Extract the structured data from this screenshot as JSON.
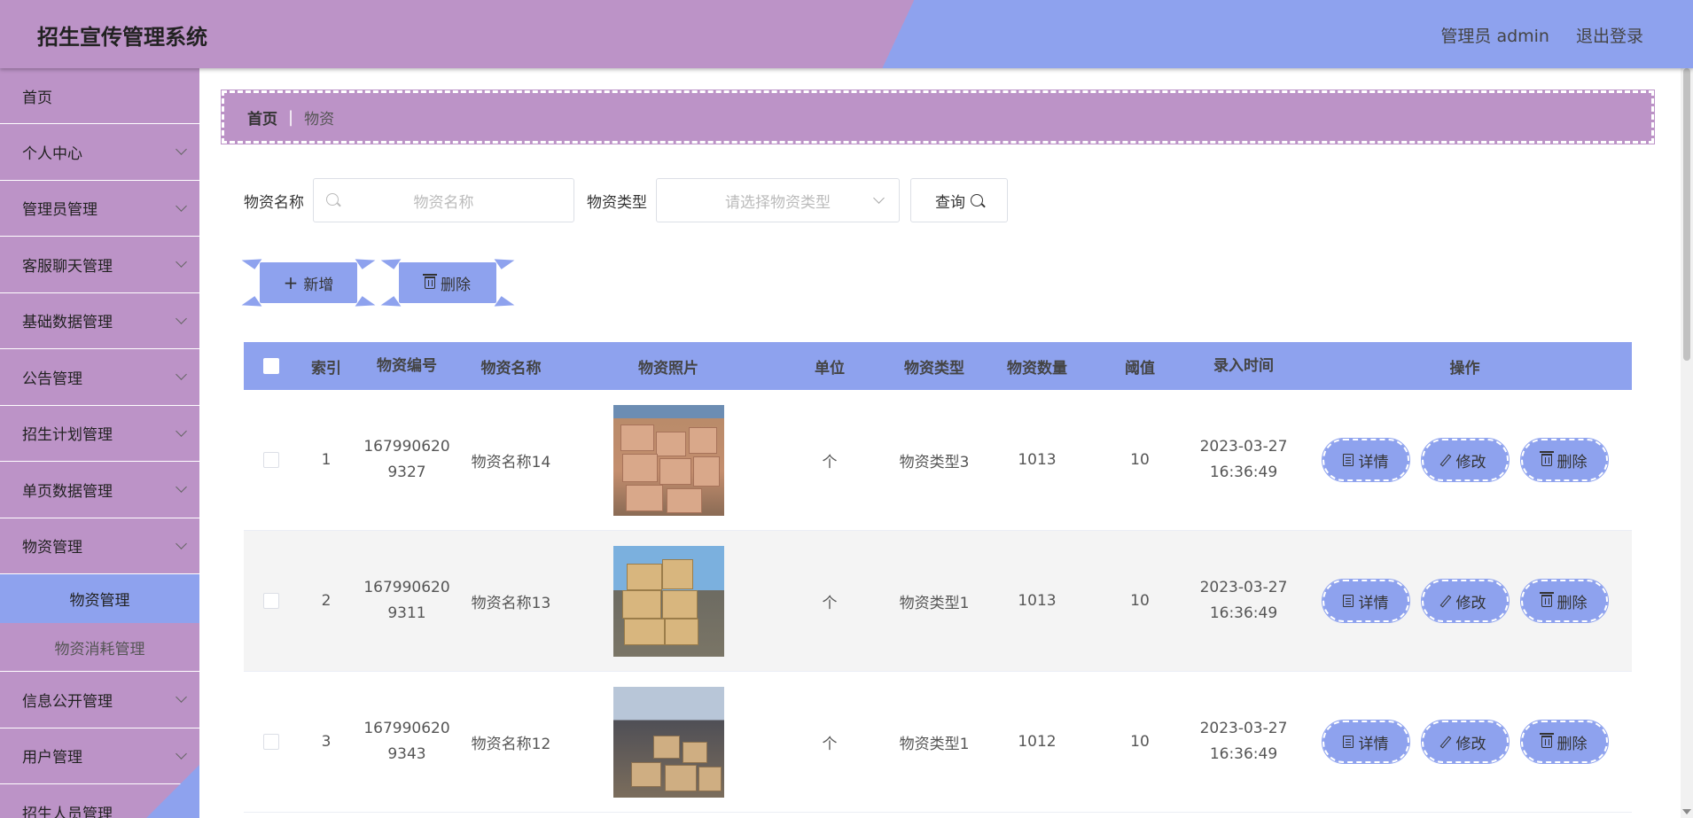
{
  "header": {
    "title": "招生宣传管理系统",
    "user_label": "管理员 admin",
    "logout_label": "退出登录"
  },
  "sidebar": {
    "items": [
      {
        "label": "首页"
      },
      {
        "label": "个人中心"
      },
      {
        "label": "管理员管理"
      },
      {
        "label": "客服聊天管理"
      },
      {
        "label": "基础数据管理"
      },
      {
        "label": "公告管理"
      },
      {
        "label": "招生计划管理"
      },
      {
        "label": "单页数据管理"
      },
      {
        "label": "物资管理"
      },
      {
        "label": "信息公开管理"
      },
      {
        "label": "用户管理"
      },
      {
        "label": "招生人员管理"
      }
    ],
    "submenu": {
      "active": "物资管理",
      "other": "物资消耗管理"
    }
  },
  "breadcrumb": {
    "home": "首页",
    "separator": "|",
    "current": "物资"
  },
  "search": {
    "name_label": "物资名称",
    "name_placeholder": "物资名称",
    "type_label": "物资类型",
    "type_placeholder": "请选择物资类型",
    "query_label": "查询"
  },
  "actions": {
    "add_label": "新增",
    "delete_label": "删除"
  },
  "table": {
    "headers": [
      "索引",
      "物资编号",
      "物资名称",
      "物资照片",
      "单位",
      "物资类型",
      "物资数量",
      "阈值",
      "录入时间",
      "操作"
    ],
    "rows": [
      {
        "index": "1",
        "code_line1": "167990620",
        "code_line2": "9327",
        "name": "物资名称14",
        "unit": "个",
        "type": "物资类型3",
        "qty": "1013",
        "threshold": "10",
        "date": "2023-03-27",
        "time": "16:36:49"
      },
      {
        "index": "2",
        "code_line1": "167990620",
        "code_line2": "9311",
        "name": "物资名称13",
        "unit": "个",
        "type": "物资类型1",
        "qty": "1013",
        "threshold": "10",
        "date": "2023-03-27",
        "time": "16:36:49"
      },
      {
        "index": "3",
        "code_line1": "167990620",
        "code_line2": "9343",
        "name": "物资名称12",
        "unit": "个",
        "type": "物资类型1",
        "qty": "1012",
        "threshold": "10",
        "date": "2023-03-27",
        "time": "16:36:49"
      }
    ],
    "ops": {
      "detail": "详情",
      "edit": "修改",
      "delete": "删除"
    }
  },
  "colors": {
    "purple": "#bc93c7",
    "blue": "#8ea2ee"
  }
}
